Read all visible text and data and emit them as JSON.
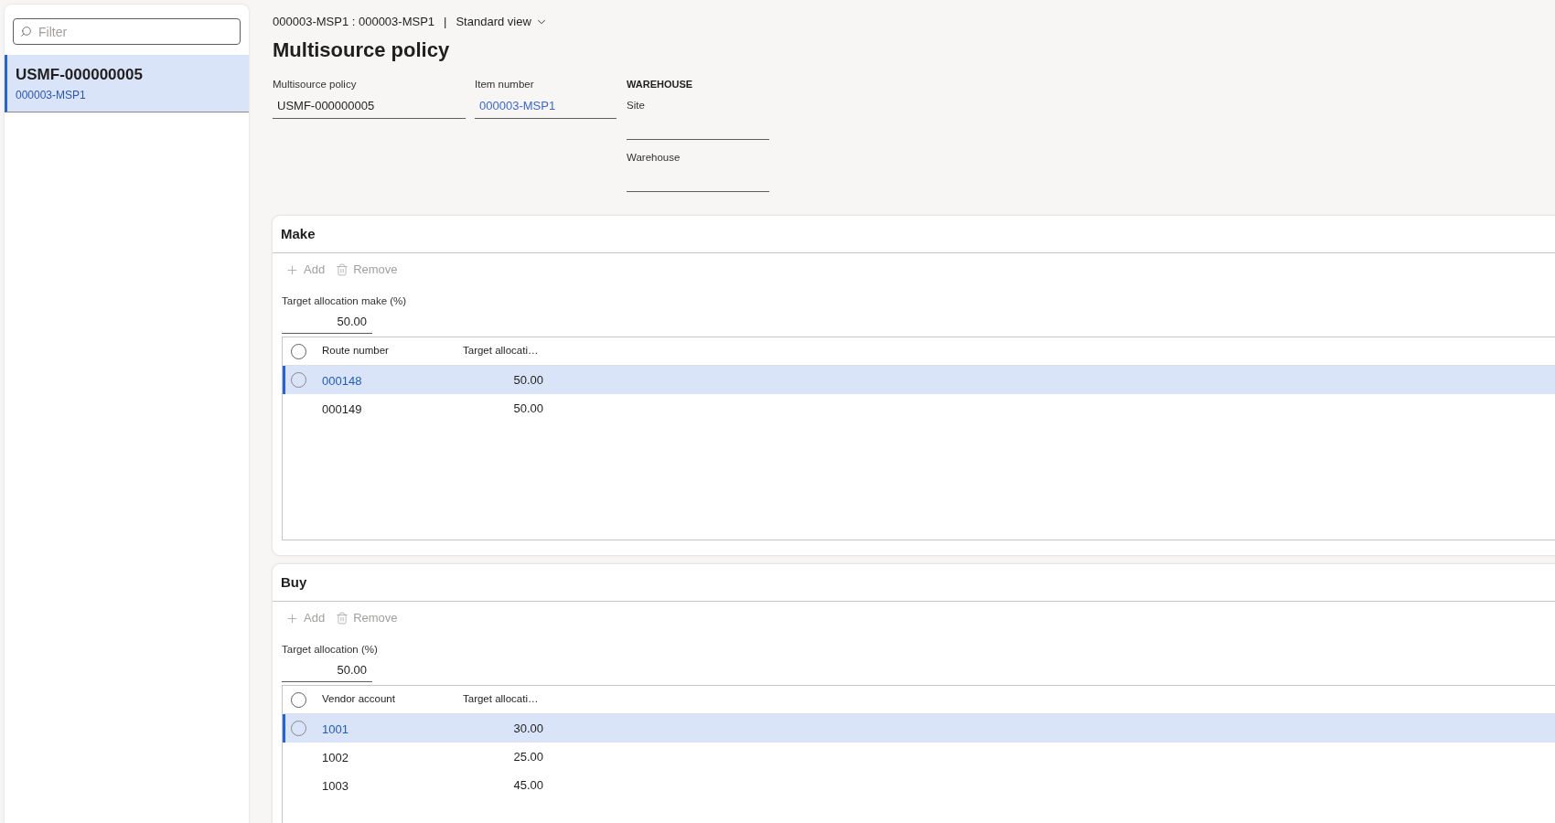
{
  "sidebar": {
    "filter": {
      "placeholder": "Filter"
    },
    "items": [
      {
        "title": "USMF-000000005",
        "subtitle": "000003-MSP1",
        "selected": true
      }
    ]
  },
  "header": {
    "breadcrumb": "000003-MSP1 : 000003-MSP1",
    "separator": "|",
    "view": "Standard view",
    "title": "Multisource policy",
    "fields": [
      {
        "label": "Multisource policy",
        "value": "USMF-000000005",
        "kind": "text"
      },
      {
        "label": "Item number",
        "value": "000003-MSP1",
        "kind": "link"
      }
    ],
    "warehouse": {
      "heading": "WAREHOUSE",
      "fields": [
        {
          "label": "Site"
        },
        {
          "label": "Warehouse"
        }
      ]
    }
  },
  "sections": [
    {
      "title": "Make",
      "actions": [
        {
          "label": "Add",
          "kind": "add",
          "disabled": true
        },
        {
          "label": "Remove",
          "kind": "remove",
          "disabled": true
        }
      ],
      "allocation": {
        "label": "Target allocation make (%)",
        "value": "50.00"
      },
      "grid": {
        "all_selected": false,
        "columns": [
          "Route number",
          "Target allocati…"
        ],
        "rows": [
          {
            "cells": [
              "000148",
              "50.00"
            ],
            "selected": true
          },
          {
            "cells": [
              "000149",
              "50.00"
            ],
            "selected": false
          }
        ]
      }
    },
    {
      "title": "Buy",
      "actions": [
        {
          "label": "Add",
          "kind": "add",
          "disabled": true
        },
        {
          "label": "Remove",
          "kind": "remove",
          "disabled": true
        }
      ],
      "allocation": {
        "label": "Target allocation (%)",
        "value": "50.00"
      },
      "grid": {
        "all_selected": false,
        "columns": [
          "Vendor account",
          "Target allocati…"
        ],
        "rows": [
          {
            "cells": [
              "1001",
              "30.00"
            ],
            "selected": true
          },
          {
            "cells": [
              "1002",
              "25.00"
            ],
            "selected": false
          },
          {
            "cells": [
              "1003",
              "45.00"
            ],
            "selected": false
          }
        ]
      }
    }
  ]
}
